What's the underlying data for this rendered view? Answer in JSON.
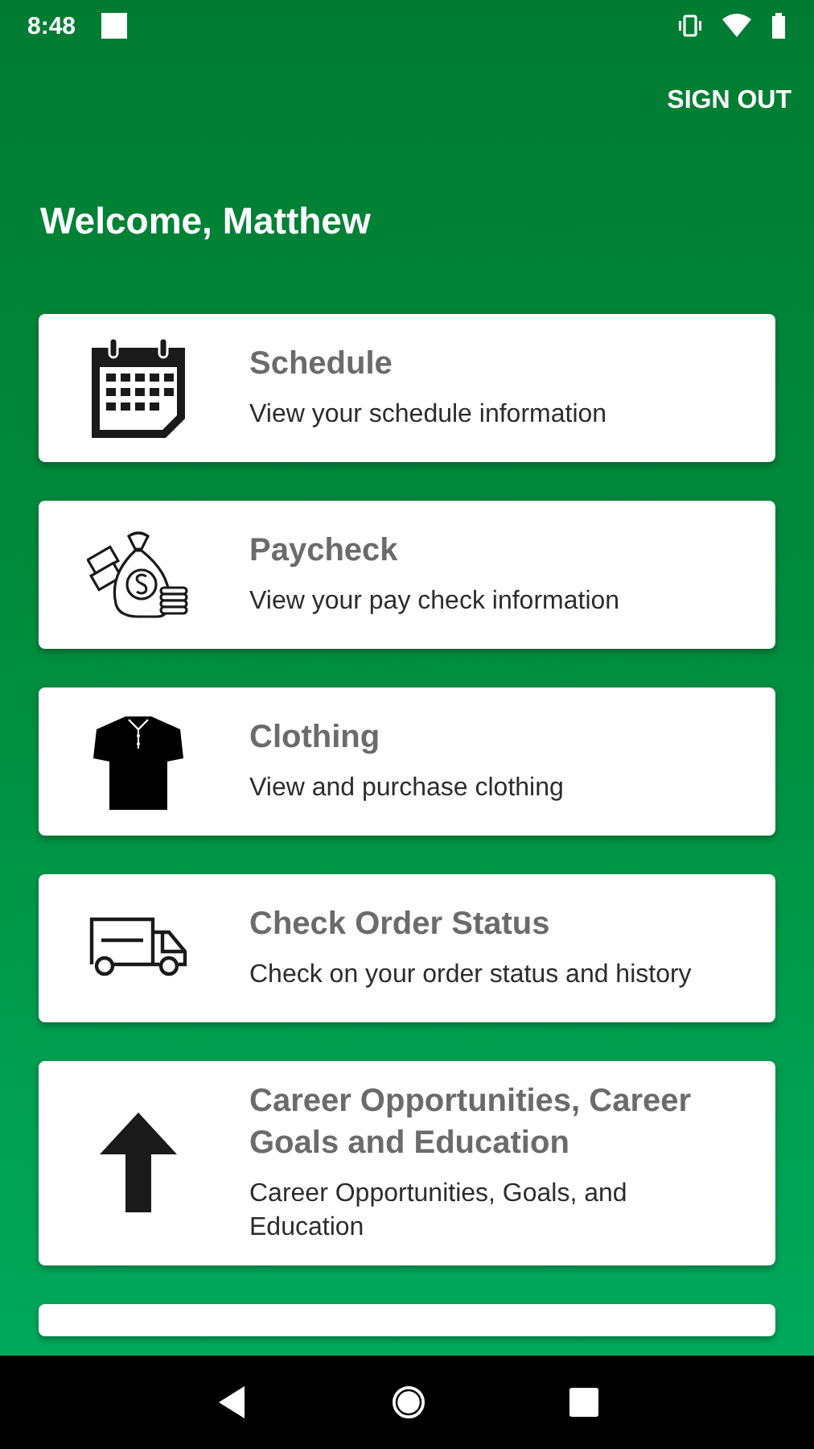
{
  "status_bar": {
    "time": "8:48"
  },
  "header": {
    "sign_out": "SIGN OUT",
    "welcome": "Welcome, Matthew"
  },
  "menu": [
    {
      "title": "Schedule",
      "subtitle": "View your schedule information"
    },
    {
      "title": "Paycheck",
      "subtitle": "View your pay check information"
    },
    {
      "title": "Clothing",
      "subtitle": "View and purchase clothing"
    },
    {
      "title": "Check Order Status",
      "subtitle": "Check on your order status and history"
    },
    {
      "title": "Career Opportunities, Career Goals and Education",
      "subtitle": "Career Opportunities, Goals, and Education"
    }
  ]
}
